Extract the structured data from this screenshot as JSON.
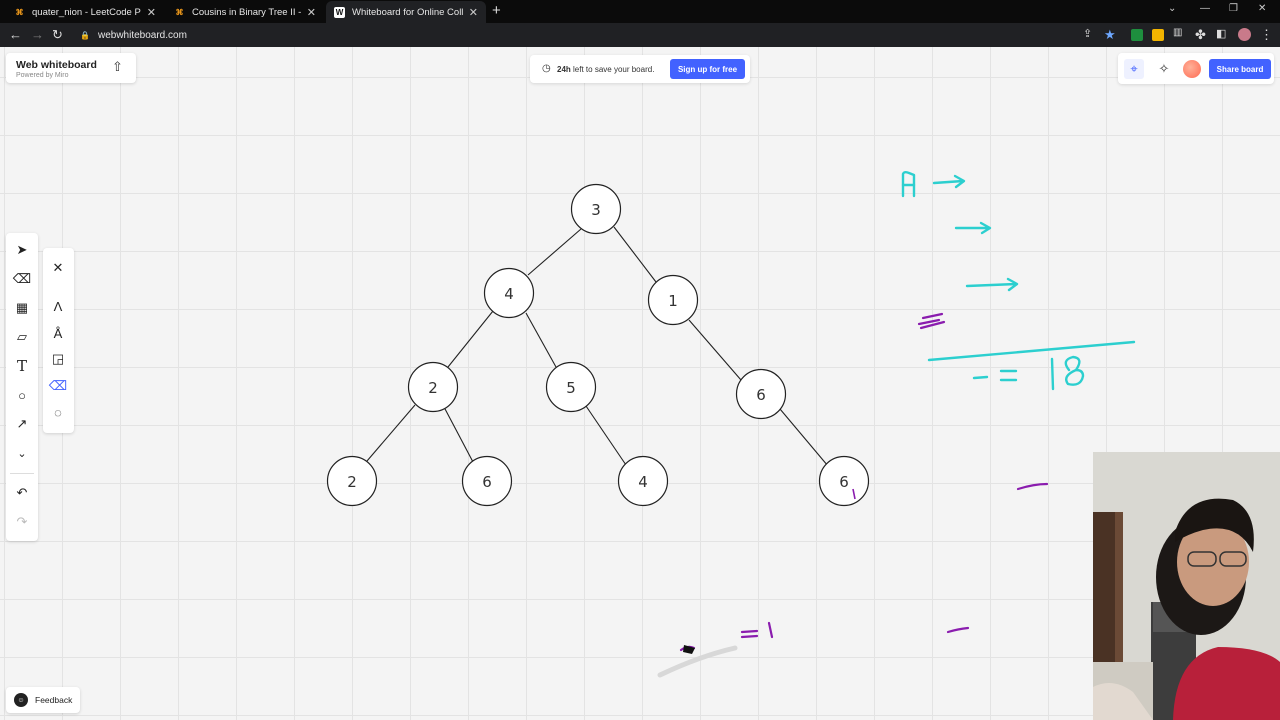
{
  "browser": {
    "tabs": [
      {
        "title": "quater_nion - LeetCode Profile",
        "favicon": "leetcode-icon",
        "active": false
      },
      {
        "title": "Cousins in Binary Tree II - LeetCo",
        "favicon": "leetcode-icon",
        "active": false
      },
      {
        "title": "Whiteboard for Online Collabora",
        "favicon": "W",
        "active": true
      }
    ],
    "url": "webwhiteboard.com"
  },
  "app": {
    "title": "Web whiteboard",
    "subtitle": "Powered by Miro",
    "save_hours": "24h",
    "save_text": "left to save your board.",
    "signup_label": "Sign up for free",
    "share_label": "Share board",
    "feedback_label": "Feedback"
  },
  "tree": {
    "nodes": [
      {
        "id": "root",
        "value": "3"
      },
      {
        "id": "l",
        "value": "4"
      },
      {
        "id": "r",
        "value": "1"
      },
      {
        "id": "ll",
        "value": "2"
      },
      {
        "id": "lr",
        "value": "5"
      },
      {
        "id": "rr",
        "value": "6"
      },
      {
        "id": "lll",
        "value": "2"
      },
      {
        "id": "llr",
        "value": "6"
      },
      {
        "id": "lrr",
        "value": "4"
      },
      {
        "id": "rrr",
        "value": "6"
      }
    ]
  },
  "annotations": {
    "sum_text": "18",
    "bottom_text": "=1"
  },
  "colors": {
    "accent": "#4262ff",
    "ink_teal": "#2ccfcf",
    "ink_purple": "#8a1cae"
  }
}
